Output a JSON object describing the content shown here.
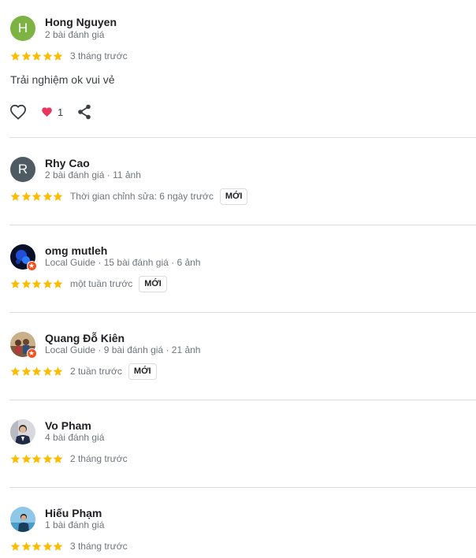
{
  "star_color": "#fbbc04",
  "new_label": "MỚI",
  "reviews": [
    {
      "name": "Hong Nguyen",
      "meta": "2 bài đánh giá",
      "avatar_letter": "H",
      "avatar_color": "#7cb342",
      "rating": 5,
      "time": "3 tháng trước",
      "text": "Trải nghiệm ok vui vẻ",
      "reaction_count": "1",
      "is_new": false
    },
    {
      "name": "Rhy Cao",
      "meta": "2 bài đánh giá · 11 ảnh",
      "avatar_letter": "R",
      "avatar_color": "#4f5b62",
      "rating": 5,
      "time": "Thời gian chỉnh sửa: 6 ngày trước",
      "is_new": true
    },
    {
      "name": "omg mutleh",
      "meta": "Local Guide · 15 bài đánh giá · 6 ảnh",
      "rating": 5,
      "time": "một tuần trước",
      "is_new": true
    },
    {
      "name": "Quang Đỗ Kiên",
      "meta": "Local Guide · 9 bài đánh giá · 21 ảnh",
      "rating": 5,
      "time": "2 tuần trước",
      "is_new": true
    },
    {
      "name": "Vo Pham",
      "meta": "4 bài đánh giá",
      "rating": 5,
      "time": "2 tháng trước",
      "is_new": false
    },
    {
      "name": "Hiếu Phạm",
      "meta": "1 bài đánh giá",
      "rating": 5,
      "time": "3 tháng trước",
      "is_new": false
    }
  ]
}
